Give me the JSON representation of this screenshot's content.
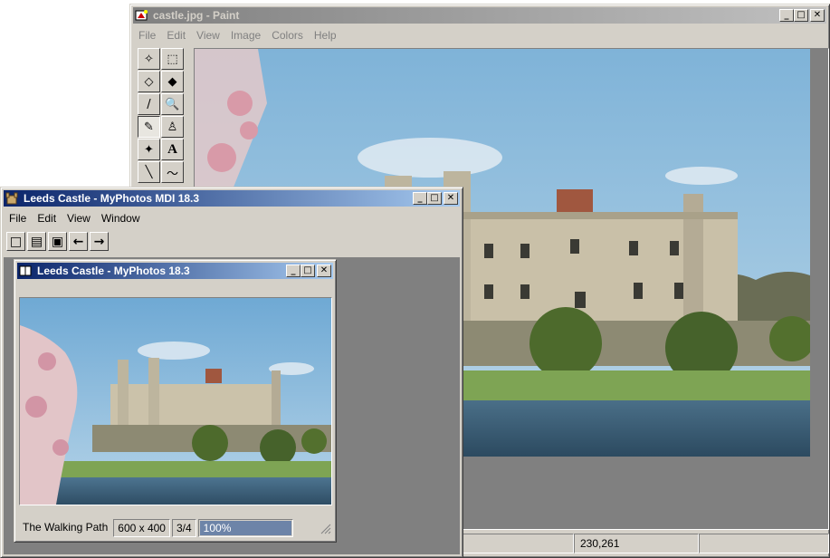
{
  "paint": {
    "title": "castle.jpg - Paint",
    "menu": [
      "File",
      "Edit",
      "View",
      "Image",
      "Colors",
      "Help"
    ],
    "status": {
      "coords": "230,261"
    },
    "tools": [
      "free-select",
      "rect-select",
      "eraser",
      "fill",
      "color-picker",
      "magnifier",
      "pencil",
      "brush",
      "airbrush",
      "text",
      "line",
      "curve"
    ],
    "tool_glyphs": [
      "✧",
      "⬚",
      "◇",
      "◆",
      "/",
      "🔍",
      "✎",
      "♙",
      "✦",
      "A",
      "╲",
      "〜"
    ]
  },
  "mdi": {
    "title": "Leeds Castle - MyPhotos MDI 18.3",
    "menu": [
      "File",
      "Edit",
      "View",
      "Window"
    ],
    "toolbar": [
      "new",
      "open",
      "save",
      "back",
      "forward"
    ],
    "toolbar_glyphs": [
      "□",
      "▤",
      "▣",
      "←",
      "→"
    ]
  },
  "child": {
    "title": "Leeds Castle - MyPhotos 18.3",
    "status": {
      "caption": "The Walking Path",
      "dimensions": "600 x 400",
      "position": "3/4",
      "zoom_label": "100%",
      "zoom_progress": 1.0
    }
  },
  "window_controls": {
    "minimize": "_",
    "maximize": "□",
    "close": "✕"
  },
  "colors": {
    "active_title_start": "#0a246a",
    "active_title_end": "#a6caf0",
    "inactive_title": "#808080",
    "face": "#d4d0c8"
  }
}
